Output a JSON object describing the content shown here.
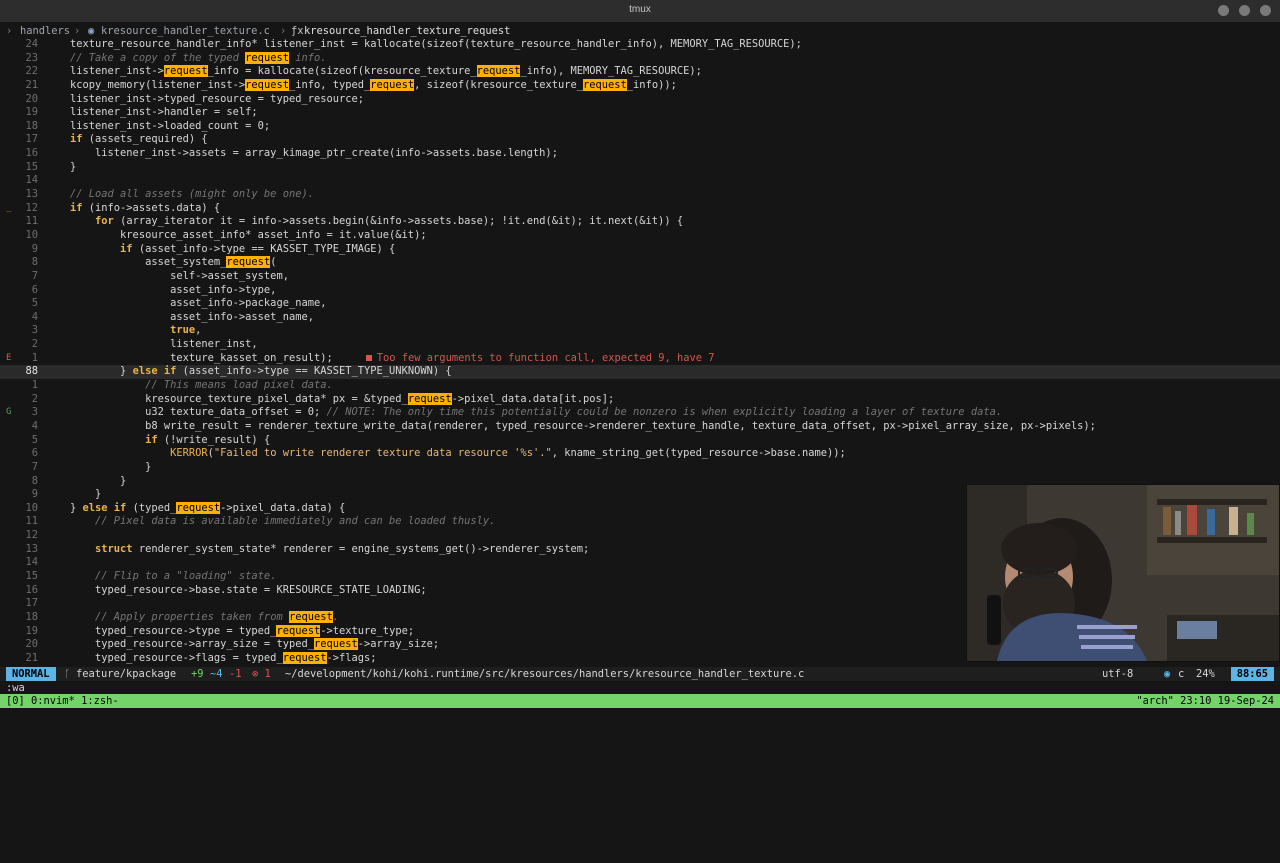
{
  "window": {
    "title": "tmux"
  },
  "winbar": {
    "folder": "handlers",
    "file": "kresource_handler_texture.c",
    "function_icon": "ƒx",
    "function": "kresource_handler_texture_request"
  },
  "code_lines": [
    {
      "sign": "",
      "num": "24",
      "tokens": [
        [
          "",
          "texture_resource_handler_info* listener_inst = kallocate(sizeof(texture_resource_handler_info), MEMORY_TAG_RESOURCE);"
        ]
      ]
    },
    {
      "sign": "",
      "num": "23",
      "tokens": [
        [
          "cm",
          "// Take a copy of the typed "
        ],
        [
          "hl",
          "request"
        ],
        [
          "cm",
          " info."
        ]
      ]
    },
    {
      "sign": "",
      "num": "22",
      "tokens": [
        [
          "",
          "listener_inst->"
        ],
        [
          "hl",
          "request"
        ],
        [
          "",
          "_info = kallocate(sizeof(kresource_texture_"
        ],
        [
          "hl",
          "request"
        ],
        [
          "",
          "_info), MEMORY_TAG_RESOURCE);"
        ]
      ]
    },
    {
      "sign": "",
      "num": "21",
      "tokens": [
        [
          "",
          "kcopy_memory(listener_inst->"
        ],
        [
          "hl",
          "request"
        ],
        [
          "",
          "_info, typed_"
        ],
        [
          "hl",
          "request"
        ],
        [
          "",
          ", sizeof(kresource_texture_"
        ],
        [
          "hl",
          "request"
        ],
        [
          "",
          "_info));"
        ]
      ]
    },
    {
      "sign": "",
      "num": "20",
      "tokens": [
        [
          "",
          "listener_inst->typed_resource = typed_resource;"
        ]
      ]
    },
    {
      "sign": "",
      "num": "19",
      "tokens": [
        [
          "",
          "listener_inst->handler = self;"
        ]
      ]
    },
    {
      "sign": "",
      "num": "18",
      "tokens": [
        [
          "",
          "listener_inst->loaded_count = 0;"
        ]
      ]
    },
    {
      "sign": "",
      "num": "17",
      "tokens": [
        [
          "kw",
          "if"
        ],
        [
          "",
          " (assets_required) {"
        ]
      ]
    },
    {
      "sign": "",
      "num": "16",
      "tokens": [
        [
          "",
          "    listener_inst->assets = array_kimage_ptr_create(info->assets.base.length);"
        ]
      ]
    },
    {
      "sign": "",
      "num": "15",
      "tokens": [
        [
          "",
          "}"
        ]
      ]
    },
    {
      "sign": "",
      "num": "14",
      "tokens": [
        [
          "",
          ""
        ]
      ]
    },
    {
      "sign": "",
      "num": "13",
      "tokens": [
        [
          "cm",
          "// Load all assets (might only be one)."
        ]
      ]
    },
    {
      "sign": "_",
      "num": "12",
      "tokens": [
        [
          "kw",
          "if"
        ],
        [
          "",
          " (info->assets.data) {"
        ]
      ]
    },
    {
      "sign": "",
      "num": "11",
      "tokens": [
        [
          "",
          "    "
        ],
        [
          "kw",
          "for"
        ],
        [
          "",
          " (array_iterator it = info->assets.begin(&info->assets.base); !it.end(&it); it.next(&it)) {"
        ]
      ]
    },
    {
      "sign": "",
      "num": "10",
      "tokens": [
        [
          "",
          "        kresource_asset_info* asset_info = it.value(&it);"
        ]
      ]
    },
    {
      "sign": "",
      "num": "9",
      "tokens": [
        [
          "",
          "        "
        ],
        [
          "kw",
          "if"
        ],
        [
          "",
          " (asset_info->type == KASSET_TYPE_IMAGE) {"
        ]
      ]
    },
    {
      "sign": "",
      "num": "8",
      "tokens": [
        [
          "",
          "            asset_system_"
        ],
        [
          "hl",
          "request"
        ],
        [
          "",
          "("
        ]
      ]
    },
    {
      "sign": "",
      "num": "7",
      "tokens": [
        [
          "",
          "                self->asset_system,"
        ]
      ]
    },
    {
      "sign": "",
      "num": "6",
      "tokens": [
        [
          "",
          "                asset_info->type,"
        ]
      ]
    },
    {
      "sign": "",
      "num": "5",
      "tokens": [
        [
          "",
          "                asset_info->package_name,"
        ]
      ]
    },
    {
      "sign": "",
      "num": "4",
      "tokens": [
        [
          "",
          "                asset_info->asset_name,"
        ]
      ]
    },
    {
      "sign": "",
      "num": "3",
      "tokens": [
        [
          "",
          "                "
        ],
        [
          "kw",
          "true"
        ],
        [
          "",
          ","
        ]
      ]
    },
    {
      "sign": "",
      "num": "2",
      "tokens": [
        [
          "",
          "                listener_inst,"
        ]
      ]
    },
    {
      "sign": "E",
      "num": "1",
      "tokens": [
        [
          "",
          "                texture_kasset_on_result);"
        ]
      ],
      "diagnostic": "Too few arguments to function call, expected 9, have 7"
    },
    {
      "sign": "",
      "num": "88",
      "current": true,
      "tokens": [
        [
          "",
          "        } "
        ],
        [
          "kw",
          "else if"
        ],
        [
          "",
          " (asset_info->type == KASSET_TYPE_UNKNOWN) {"
        ]
      ]
    },
    {
      "sign": "",
      "num": "1",
      "tokens": [
        [
          "",
          "            "
        ],
        [
          "cm",
          "// This means load pixel data."
        ]
      ]
    },
    {
      "sign": "",
      "num": "2",
      "tokens": [
        [
          "",
          "            kresource_texture_pixel_data* px = &typed_"
        ],
        [
          "hl",
          "request"
        ],
        [
          "",
          "->pixel_data.data[it.pos];"
        ]
      ]
    },
    {
      "sign": "G",
      "num": "3",
      "tokens": [
        [
          "",
          "            u32 texture_data_offset = 0; "
        ],
        [
          "cm",
          "// NOTE: The only time this potentially could be nonzero is when explicitly loading a layer of texture data."
        ]
      ]
    },
    {
      "sign": "",
      "num": "4",
      "tokens": [
        [
          "",
          "            b8 write_result = renderer_texture_write_data(renderer, typed_resource->renderer_texture_handle, texture_data_offset, px->pixel_array_size, px->pixels);"
        ]
      ]
    },
    {
      "sign": "",
      "num": "5",
      "tokens": [
        [
          "",
          "            "
        ],
        [
          "kw",
          "if"
        ],
        [
          "",
          " (!write_result) {"
        ]
      ]
    },
    {
      "sign": "",
      "num": "6",
      "tokens": [
        [
          "",
          "                "
        ],
        [
          "mc",
          "KERROR"
        ],
        [
          "",
          "("
        ],
        [
          "st",
          "\"Failed to write renderer texture data resource '%s'.\""
        ],
        [
          "",
          ", kname_string_get(typed_resource->base.name));"
        ]
      ]
    },
    {
      "sign": "",
      "num": "7",
      "tokens": [
        [
          "",
          "            }"
        ]
      ]
    },
    {
      "sign": "",
      "num": "8",
      "tokens": [
        [
          "",
          "        }"
        ]
      ]
    },
    {
      "sign": "",
      "num": "9",
      "tokens": [
        [
          "",
          "    }"
        ]
      ]
    },
    {
      "sign": "",
      "num": "10",
      "tokens": [
        [
          "",
          "} "
        ],
        [
          "kw",
          "else if"
        ],
        [
          "",
          " (typed_"
        ],
        [
          "hl",
          "request"
        ],
        [
          "",
          "->pixel_data.data) {"
        ]
      ]
    },
    {
      "sign": "",
      "num": "11",
      "tokens": [
        [
          "",
          "    "
        ],
        [
          "cm",
          "// Pixel data is available immediately and can be loaded thusly."
        ]
      ]
    },
    {
      "sign": "",
      "num": "12",
      "tokens": [
        [
          "",
          ""
        ]
      ]
    },
    {
      "sign": "",
      "num": "13",
      "tokens": [
        [
          "",
          "    "
        ],
        [
          "kw",
          "struct"
        ],
        [
          "",
          " renderer_system_state* renderer = engine_systems_get()->renderer_system;"
        ]
      ]
    },
    {
      "sign": "",
      "num": "14",
      "tokens": [
        [
          "",
          ""
        ]
      ]
    },
    {
      "sign": "",
      "num": "15",
      "tokens": [
        [
          "",
          "    "
        ],
        [
          "cm",
          "// Flip to a \"loading\" state."
        ]
      ]
    },
    {
      "sign": "",
      "num": "16",
      "tokens": [
        [
          "",
          "    typed_resource->base.state = KRESOURCE_STATE_LOADING;"
        ]
      ]
    },
    {
      "sign": "",
      "num": "17",
      "tokens": [
        [
          "",
          ""
        ]
      ]
    },
    {
      "sign": "",
      "num": "18",
      "tokens": [
        [
          "",
          "    "
        ],
        [
          "cm",
          "// Apply properties taken from "
        ],
        [
          "hl",
          "request"
        ],
        [
          "cm",
          "."
        ]
      ]
    },
    {
      "sign": "",
      "num": "19",
      "tokens": [
        [
          "",
          "    typed_resource->type = typed_"
        ],
        [
          "hl",
          "request"
        ],
        [
          "",
          "->texture_type;"
        ]
      ]
    },
    {
      "sign": "",
      "num": "20",
      "tokens": [
        [
          "",
          "    typed_resource->array_size = typed_"
        ],
        [
          "hl",
          "request"
        ],
        [
          "",
          "->array_size;"
        ]
      ]
    },
    {
      "sign": "",
      "num": "21",
      "tokens": [
        [
          "",
          "    typed_resource->flags = typed_"
        ],
        [
          "hl",
          "request"
        ],
        [
          "",
          "->flags;"
        ]
      ]
    }
  ],
  "statusline": {
    "mode": "NORMAL",
    "branch": "feature/kpackage",
    "git_added": "+9",
    "git_changed": "~4",
    "git_removed": "-1",
    "errors": "⊗ 1",
    "path": "~/development/kohi/kohi.runtime/src/kresources/handlers/kresource_handler_texture.c",
    "encoding": "utf-8",
    "filetype": "c",
    "percent": "24%",
    "position": "88:65"
  },
  "cmdline": ":wa",
  "tmux": {
    "windows": "[0] 0:nvim* 1:zsh-",
    "right": "\"arch\" 23:10 19-Sep-24"
  },
  "colors": {
    "accent": "#5fb4e6",
    "tmux_bar": "#74d46a",
    "search_highlight": "#ffb000",
    "keyword": "#ecb34a",
    "error": "#d9534f"
  }
}
